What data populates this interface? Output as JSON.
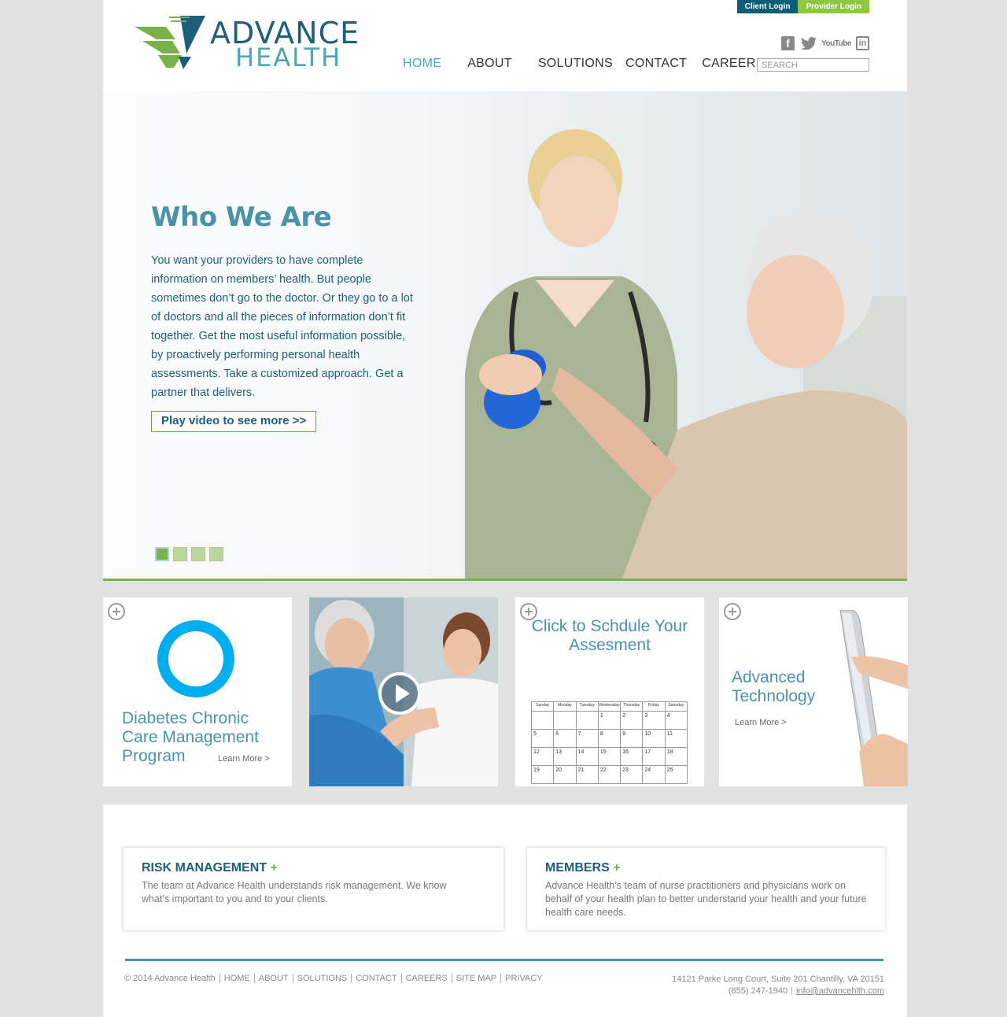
{
  "header": {
    "logo_top": "ADVANCE",
    "logo_bottom": "HEALTH",
    "client_login": "Client Login",
    "provider_login": "Provider Login",
    "social": {
      "facebook": "f",
      "twitter": "twitter-icon",
      "youtube": "YouTube",
      "linkedin": "in"
    },
    "nav": [
      "HOME",
      "ABOUT",
      "SOLUTIONS",
      "CONTACT",
      "CAREERS"
    ],
    "nav_active": "HOME",
    "search_placeholder": "SEARCH"
  },
  "hero": {
    "title": "Who We Are",
    "text": "You want your providers to have complete information on members’ health. But people sometimes don’t go to the doctor. Or they go to a lot of doctors and all the pieces of information don’t fit together. Get the most useful information possible, by proactively performing personal health assessments. Take a customized approach. Get a partner that delivers.",
    "cta": "Play video to see more >>",
    "slides_total": 4,
    "slide_active": 1
  },
  "tiles": {
    "diabetes": {
      "title": "Diabetes Chronic Care Management Program",
      "link": "Learn More >"
    },
    "video": {
      "icon": "play-icon"
    },
    "schedule": {
      "title": "Click to Schdule Your Assesment",
      "calendar": {
        "days": [
          "Sunday",
          "Monday",
          "Tuesday",
          "Wednesday",
          "Thursday",
          "Friday",
          "Saturday"
        ],
        "rows": [
          [
            "",
            "",
            "",
            "1",
            "2",
            "3",
            "4"
          ],
          [
            "5",
            "6",
            "7",
            "8",
            "9",
            "10",
            "11"
          ],
          [
            "12",
            "13",
            "14",
            "15",
            "16",
            "17",
            "18"
          ],
          [
            "19",
            "20",
            "21",
            "22",
            "23",
            "24",
            "25"
          ]
        ]
      }
    },
    "technology": {
      "title": "Advanced Technology",
      "link": "Learn More >"
    }
  },
  "cards": {
    "risk": {
      "title": "RISK MANAGEMENT",
      "plus": "+",
      "text": "The team at Advance Health understands risk management. We know what’s important to you and to your clients."
    },
    "members": {
      "title": "MEMBERS",
      "plus": "+",
      "text": "Advance Health’s team of nurse practitioners and physicians work on behalf of your health plan to better understand your health and your future health care needs."
    }
  },
  "footer": {
    "copyright": "© 2014 Advance Health",
    "links": [
      "HOME",
      "ABOUT",
      "SOLUTIONS",
      "CONTACT",
      "CAREERS",
      "SITE MAP",
      "PRIVACY"
    ],
    "address": "14121 Parke Long Court, Suite 201 Chantilly, VA 20151",
    "phone": "(855) 247-1940",
    "email": "info@advancehlth.com"
  },
  "colors": {
    "teal_dark": "#1d5f78",
    "teal_light": "#4a92aa",
    "green": "#7ab24a",
    "ring_blue": "#00aeef"
  }
}
